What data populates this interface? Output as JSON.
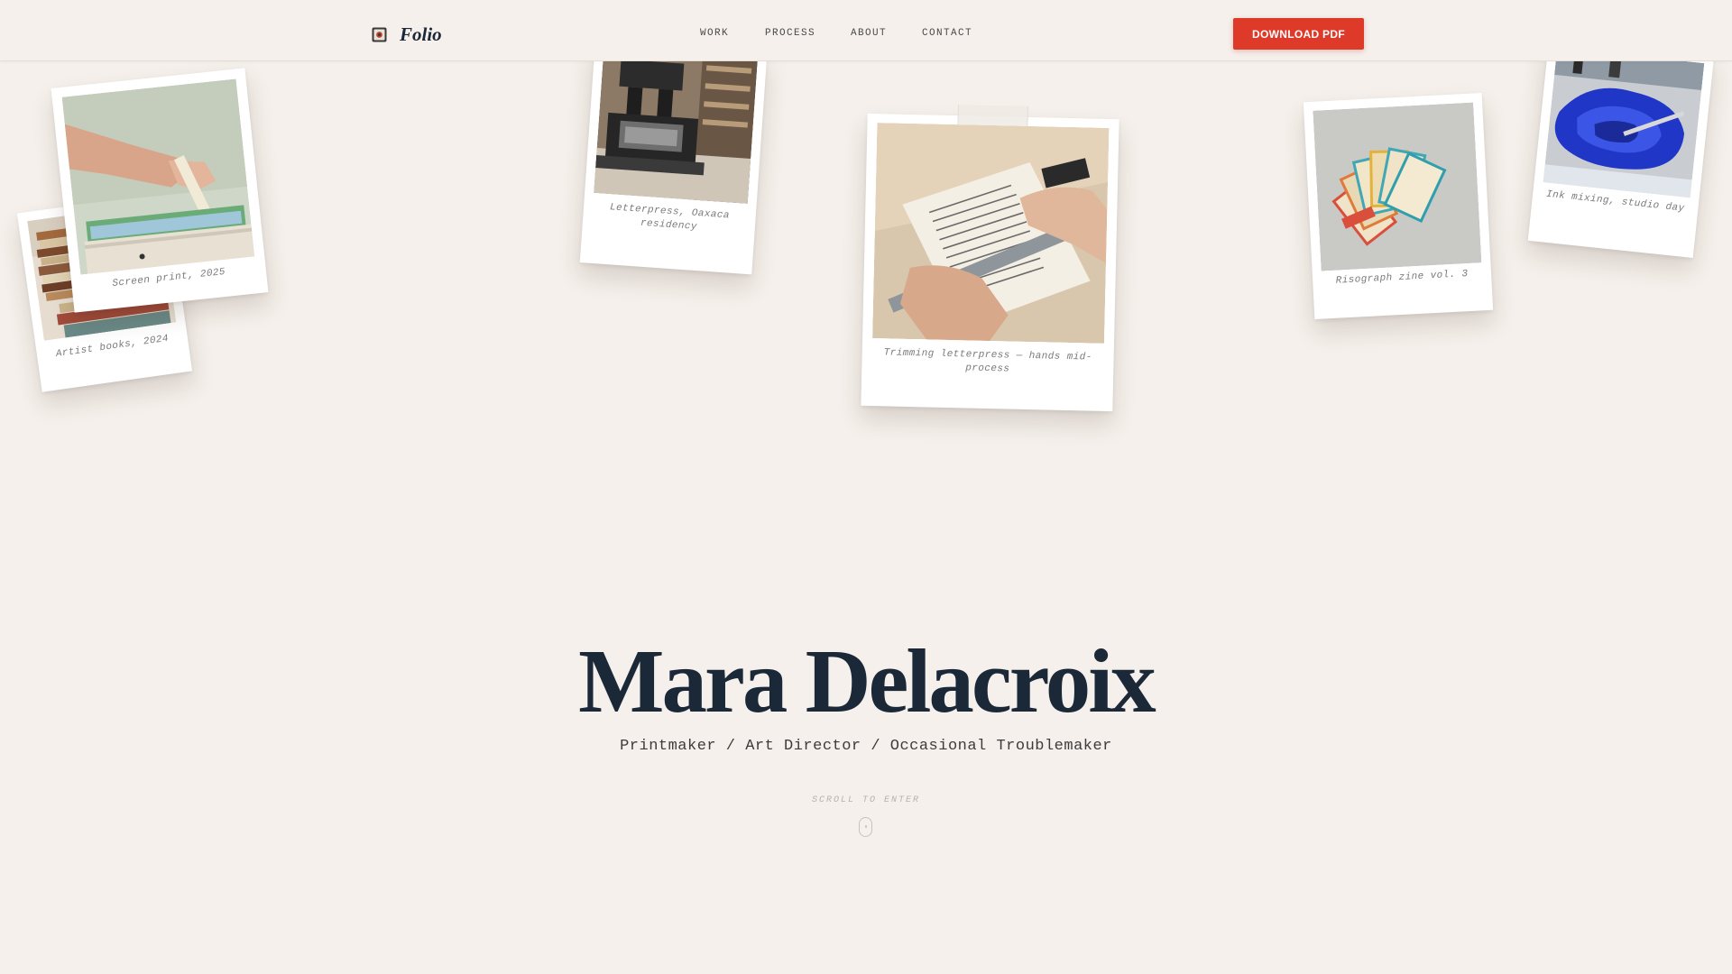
{
  "brand": {
    "name": "Folio",
    "icon": "camera-icon"
  },
  "nav": {
    "links": [
      {
        "label": "WORK",
        "name": "nav-link-work"
      },
      {
        "label": "PROCESS",
        "name": "nav-link-process"
      },
      {
        "label": "ABOUT",
        "name": "nav-link-about"
      },
      {
        "label": "CONTACT",
        "name": "nav-link-contact"
      }
    ],
    "cta_label": "DOWNLOAD PDF"
  },
  "gallery": [
    {
      "caption": "Artist books, 2024",
      "subject": "stacked-books"
    },
    {
      "caption": "Screen print, 2025",
      "subject": "screen-printing"
    },
    {
      "caption": "Letterpress, Oaxaca residency",
      "subject": "letterpress-machine"
    },
    {
      "caption": "Trimming letterpress — hands mid-process",
      "subject": "hands-trimming-paper"
    },
    {
      "caption": "Risograph zine vol. 3",
      "subject": "risograph-zines"
    },
    {
      "caption": "Ink mixing, studio day",
      "subject": "blue-ink-mixing"
    }
  ],
  "hero": {
    "name": "Mara Delacroix",
    "subtitle": "Printmaker / Art Director / Occasional Troublemaker",
    "scroll_hint": "SCROLL TO ENTER",
    "scroll_icon": "mouse-scroll-icon"
  },
  "colors": {
    "background": "#f5f0eb",
    "text_dark": "#1b2838",
    "accent": "#dd3a29"
  }
}
